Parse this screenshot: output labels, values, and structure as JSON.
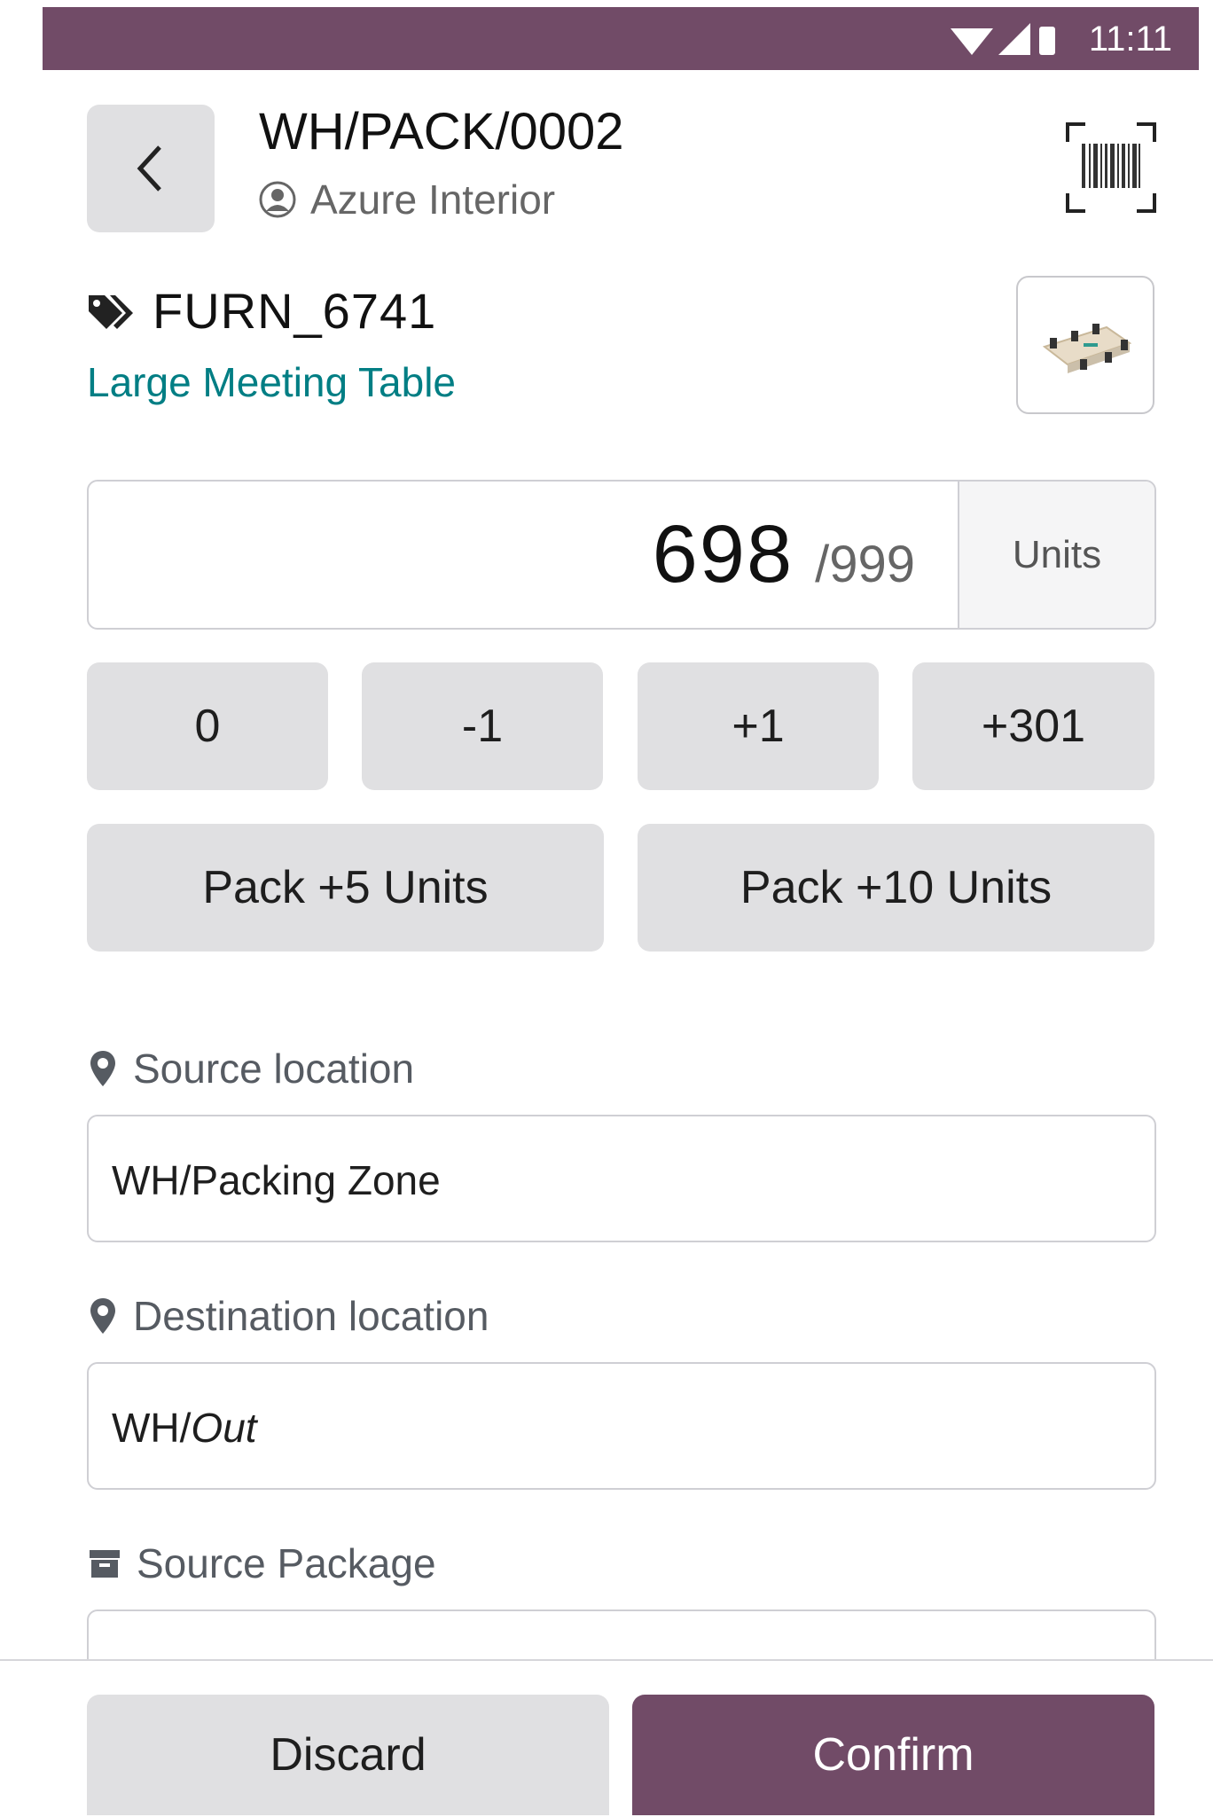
{
  "status_bar": {
    "time": "11:11"
  },
  "header": {
    "title": "WH/PACK/0002",
    "partner": "Azure Interior"
  },
  "product": {
    "code": "FURN_6741",
    "name": "Large Meeting Table"
  },
  "quantity": {
    "value": "698",
    "total": "/999",
    "uom": "Units"
  },
  "qty_buttons": [
    "0",
    "-1",
    "+1",
    "+301"
  ],
  "pack_buttons": [
    "Pack +5 Units",
    "Pack +10 Units"
  ],
  "source_location": {
    "label": "Source location",
    "value": "WH/Packing Zone"
  },
  "destination_location": {
    "label": "Destination location",
    "prefix": "WH/",
    "value_italic": "Out"
  },
  "source_package": {
    "label": "Source Package"
  },
  "footer": {
    "discard": "Discard",
    "confirm": "Confirm"
  },
  "colors": {
    "brand": "#714b67",
    "link": "#017e84",
    "button_grey": "#e0e0e2"
  }
}
